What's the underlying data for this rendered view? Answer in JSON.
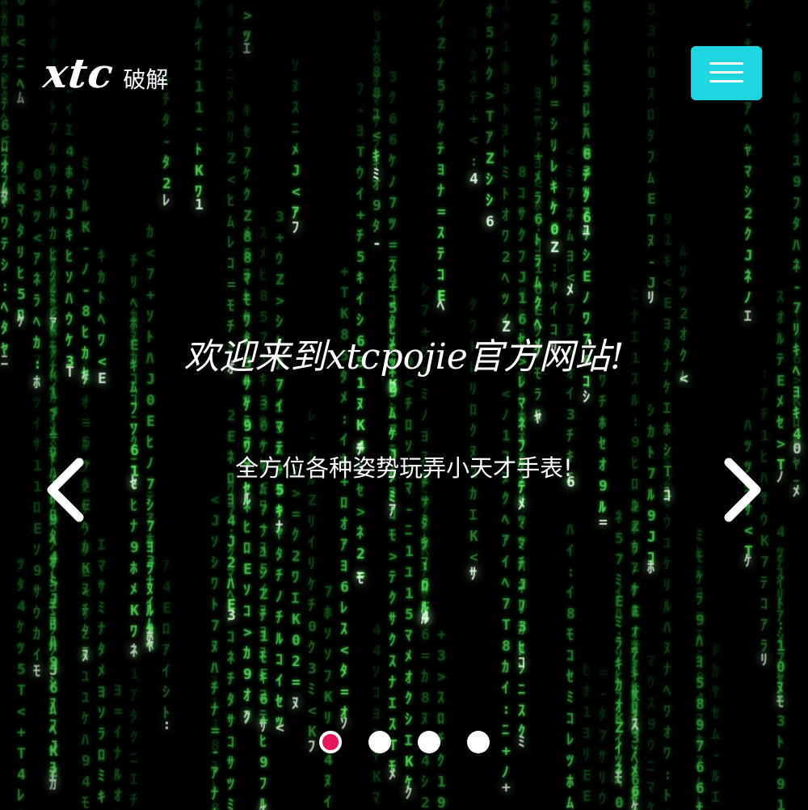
{
  "header": {
    "logo_main": "xtc",
    "logo_sub": "破解",
    "menu_button": "hamburger-menu"
  },
  "slide": {
    "headline": "欢迎来到xtcpojie官方网站!",
    "subline": "全方位各种姿势玩弄小天才手表!",
    "prev": "chevron-left-icon",
    "next": "chevron-right-icon"
  },
  "carousel": {
    "dot_count": 4,
    "active_index": 0
  },
  "colors": {
    "menu_button_bg": "#1ed6e0",
    "active_dot": "#e8175d",
    "matrix_green": "#3bff5a"
  }
}
